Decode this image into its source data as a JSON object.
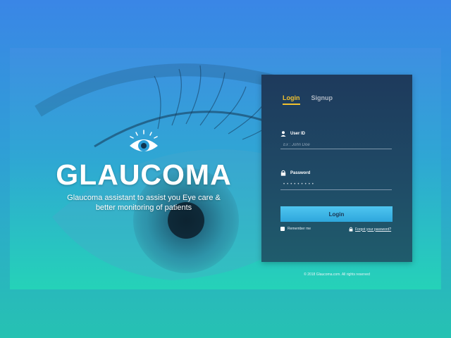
{
  "brand": {
    "title": "GLAUCOMA",
    "tagline_line1": "Glaucoma assistant to assist you Eye care &",
    "tagline_line2": "better monitoring of patients"
  },
  "auth": {
    "tabs": [
      {
        "label": "Login",
        "active": true
      },
      {
        "label": "Signup",
        "active": false
      }
    ],
    "user_id": {
      "label": "User ID",
      "placeholder": "Ex : John Doe",
      "icon": "user-icon"
    },
    "password": {
      "label": "Password",
      "value_mask": "•••••••••",
      "icon": "lock-icon"
    },
    "submit_label": "Login",
    "remember_label": "Remember me",
    "forgot_label": "Forgot your password?"
  },
  "footer": {
    "text": "© 2018 Glaucoma.com. All rights reserved"
  },
  "colors": {
    "accent_tab": "#f2c12e",
    "button": "#3cb6e8",
    "card": "#1e3a5c"
  }
}
